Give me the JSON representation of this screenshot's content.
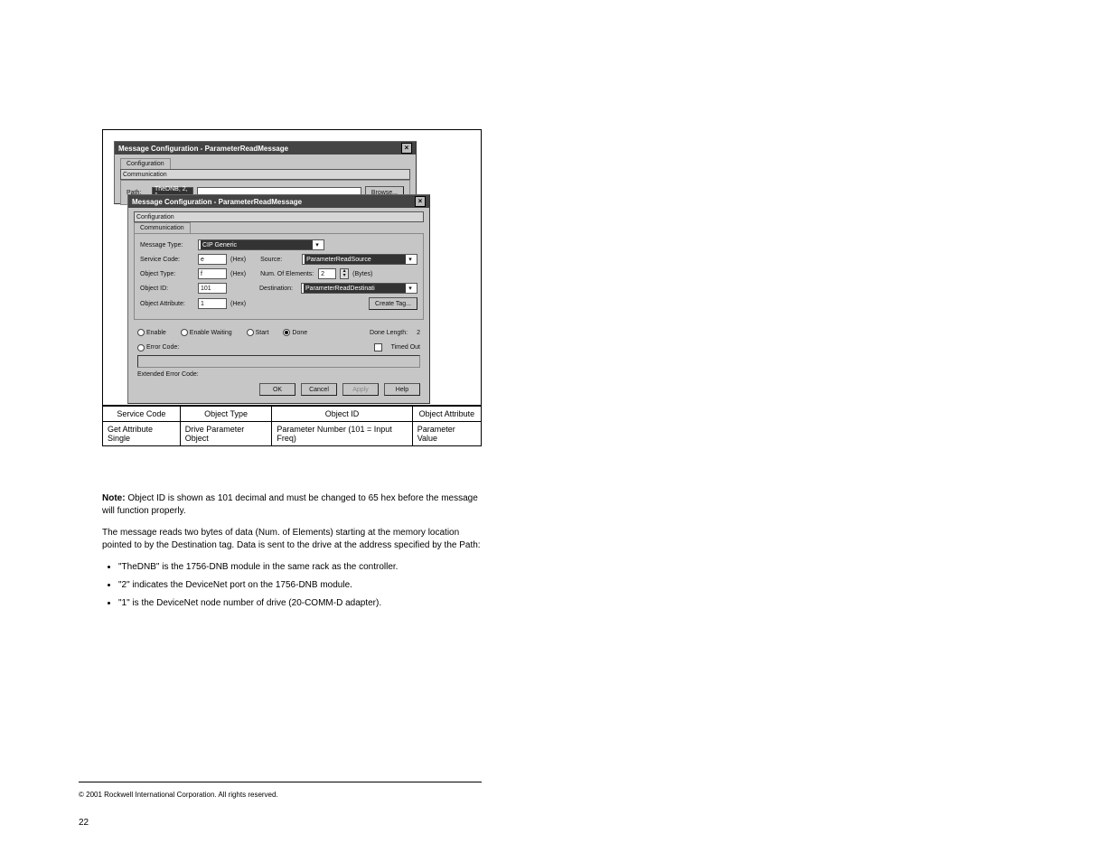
{
  "dialog": {
    "title": "Message Configuration - ParameterReadMessage",
    "tabs": {
      "config": "Configuration",
      "comm": "Communication"
    },
    "back": {
      "path_label": "Path:",
      "path_value": "TheDNB, 2, 1",
      "browse": "Browse..."
    },
    "front": {
      "msg_type_label": "Message Type:",
      "msg_type_value": "CIP Generic",
      "service_code_label": "Service Code:",
      "service_code_value": "e",
      "hex": "(Hex)",
      "object_type_label": "Object Type:",
      "object_type_value": "f",
      "object_id_label": "Object ID:",
      "object_id_value": "101",
      "object_attr_label": "Object Attribute:",
      "object_attr_value": "1",
      "source_label": "Source:",
      "source_value": "ParameterReadSource",
      "numel_label": "Num. Of Elements:",
      "numel_value": "2",
      "bytes": "(Bytes)",
      "dest_label": "Destination:",
      "dest_value": "ParameterReadDestinati",
      "create_tag": "Create Tag...",
      "enable": "Enable",
      "enable_waiting": "Enable Waiting",
      "start": "Start",
      "done": "Done",
      "done_len_label": "Done Length:",
      "done_len_value": "2",
      "error_code": "Error Code:",
      "timed_out": "Timed Out",
      "extended": "Extended Error Code:",
      "ok": "OK",
      "cancel": "Cancel",
      "apply": "Apply",
      "help": "Help"
    }
  },
  "table": {
    "headers": [
      "Service Code",
      "Object Type",
      "Object ID",
      "Object Attribute"
    ],
    "row": [
      "Get Attribute Single",
      "Drive Parameter Object",
      "Parameter Number (101 = Input Freq)",
      "Parameter Value"
    ]
  },
  "body": {
    "note_label": "Note:",
    "note_text": " Object ID is shown as 101 decimal and must be changed to 65 hex before the message will function properly.",
    "p2": "The message reads two bytes of data (Num. of Elements) starting at the memory location pointed to by the Destination tag. Data is sent to the drive at the address specified by the Path:",
    "li1": "\"TheDNB\" is the 1756-DNB module in the same rack as the controller.",
    "li2": "\"2\" indicates the DeviceNet port on the 1756-DNB module.",
    "li3": "\"1\" is the DeviceNet node number of drive (20-COMM-D adapter)."
  },
  "footer": {
    "hr_text": "",
    "line": "© 2001 Rockwell International Corporation. All rights reserved.",
    "page": "22"
  }
}
